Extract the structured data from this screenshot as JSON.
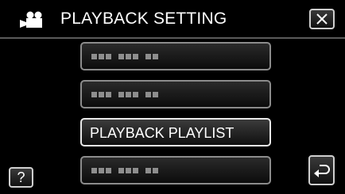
{
  "header": {
    "title": "PLAYBACK SETTING",
    "mode_icon": "video-camera-icon",
    "close_icon": "close-x-icon"
  },
  "menu": {
    "items": [
      {
        "label": "",
        "obscured": true
      },
      {
        "label": "",
        "obscured": true
      },
      {
        "label": "PLAYBACK PLAYLIST",
        "obscured": false
      },
      {
        "label": "",
        "obscured": true
      }
    ]
  },
  "footer": {
    "help_label": "?",
    "back_icon": "return-arrow-icon"
  },
  "colors": {
    "background": "#000000",
    "text": "#ffffff",
    "button_border": "#cfcfcf",
    "placeholder_dots": "#8e8e8e"
  }
}
